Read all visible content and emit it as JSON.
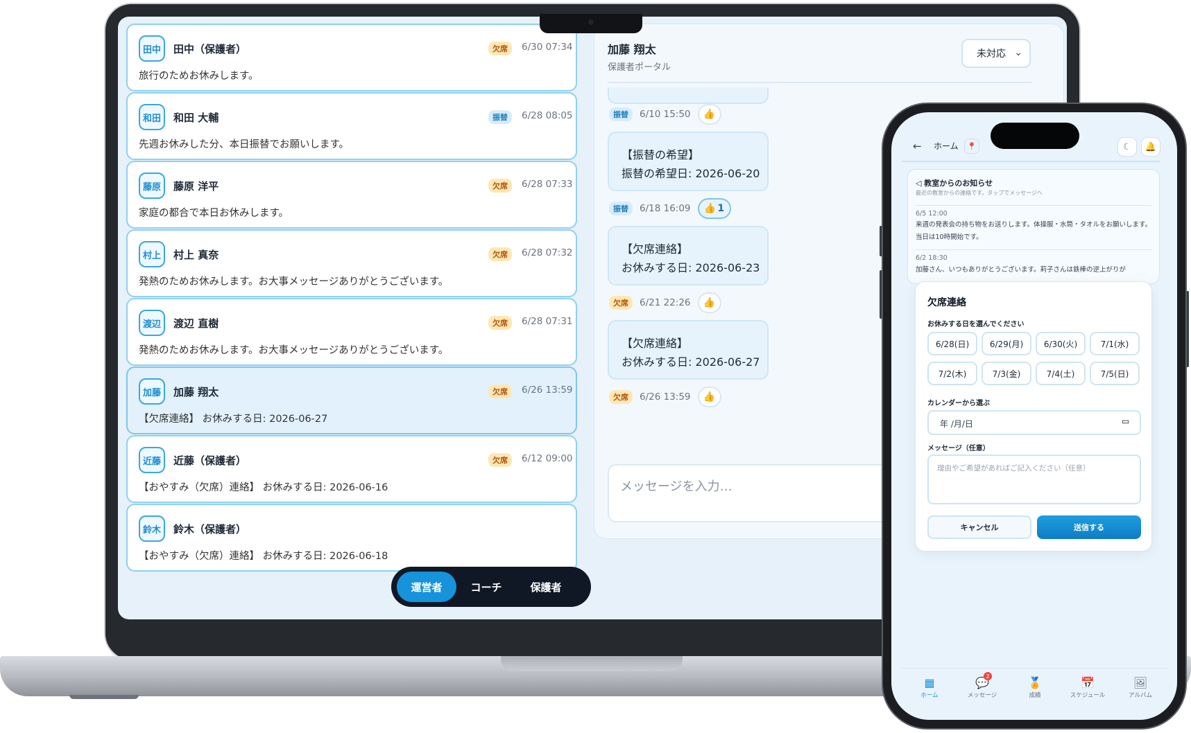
{
  "conversations": [
    {
      "badge": "田中",
      "name": "田中（保護者）",
      "tag": "欠席",
      "tag_type": "kesseki",
      "time": "6/30 07:34",
      "message": "旅行のためお休みします。"
    },
    {
      "badge": "和田",
      "name": "和田 大輔",
      "tag": "振替",
      "tag_type": "furikae",
      "time": "6/28 08:05",
      "message": "先週お休みした分、本日振替でお願いします。"
    },
    {
      "badge": "藤原",
      "name": "藤原 洋平",
      "tag": "欠席",
      "tag_type": "kesseki",
      "time": "6/28 07:33",
      "message": "家庭の都合で本日お休みします。"
    },
    {
      "badge": "村上",
      "name": "村上 真奈",
      "tag": "欠席",
      "tag_type": "kesseki",
      "time": "6/28 07:32",
      "message": "発熱のためお休みします。お大事メッセージありがとうございます。"
    },
    {
      "badge": "渡辺",
      "name": "渡辺 直樹",
      "tag": "欠席",
      "tag_type": "kesseki",
      "time": "6/28 07:31",
      "message": "発熱のためお休みします。お大事メッセージありがとうございます。"
    },
    {
      "badge": "加藤",
      "name": "加藤 翔太",
      "tag": "欠席",
      "tag_type": "kesseki",
      "time": "6/26 13:59",
      "message": "【欠席連絡】 お休みする日: 2026-06-27"
    },
    {
      "badge": "近藤",
      "name": "近藤（保護者）",
      "tag": "欠席",
      "tag_type": "kesseki",
      "time": "6/12 09:00",
      "message": "【おやすみ（欠席）連絡】 お休みする日: 2026-06-16"
    },
    {
      "badge": "鈴木",
      "name": "鈴木（保護者）",
      "tag": "",
      "tag_type": "",
      "time": "",
      "message": "【おやすみ（欠席）連絡】 お休みする日: 2026-06-18"
    }
  ],
  "chat": {
    "name": "加藤 翔太",
    "subtitle": "保護者ポータル",
    "status": "未対応",
    "messages": [
      {
        "tag": "振替",
        "tag_type": "furikae",
        "time": "6/10 15:50",
        "like": "👍",
        "like_count": ""
      },
      {
        "bubble_line1": "【振替の希望】",
        "bubble_line2": "振替の希望日: 2026-06-20"
      },
      {
        "tag": "振替",
        "tag_type": "furikae",
        "time": "6/18 16:09",
        "like": "👍",
        "like_count": "1"
      },
      {
        "bubble_line1": "【欠席連絡】",
        "bubble_line2": "お休みする日: 2026-06-23"
      },
      {
        "tag": "欠席",
        "tag_type": "kesseki",
        "time": "6/21 22:26",
        "like": "👍",
        "like_count": ""
      },
      {
        "bubble_line1": "【欠席連絡】",
        "bubble_line2": "お休みする日: 2026-06-27"
      },
      {
        "tag": "欠席",
        "tag_type": "kesseki",
        "time": "6/26 13:59",
        "like": "👍",
        "like_count": ""
      }
    ],
    "input_placeholder": "メッセージを入力…"
  },
  "role_switch": {
    "items": [
      "運営者",
      "コーチ",
      "保護者"
    ],
    "active": "運営者"
  },
  "phone": {
    "header": {
      "back": "←",
      "title": "ホーム",
      "pin": "📍",
      "theme": "☾",
      "bell": "🔔"
    },
    "notice": {
      "title": "◁ 教室からのお知らせ",
      "subtitle": "最近の教室からの連絡です。タップでメッセージへ",
      "items": [
        {
          "date": "6/5 12:00",
          "text": "来週の発表会の持ち物をお送りします。体操服・水筒・タオルをお願いします。当日は10時開始です。"
        },
        {
          "date": "6/2 18:30",
          "text": "加藤さん、いつもありがとうございます。莉子さんは鉄棒の逆上がりが"
        }
      ]
    },
    "modal": {
      "title": "欠席連絡",
      "choose_label": "お休みする日を選んでください",
      "dates": [
        "6/28(日)",
        "6/29(月)",
        "6/30(火)",
        "7/1(水)",
        "7/2(木)",
        "7/3(金)",
        "7/4(土)",
        "7/5(日)"
      ],
      "calendar_label": "カレンダーから選ぶ",
      "calendar_value": "年 /月/日",
      "message_label": "メッセージ（任意）",
      "message_placeholder": "理由やご希望があればご記入ください（任意）",
      "cancel": "キャンセル",
      "send": "送信する"
    },
    "tabs": [
      {
        "label": "ホーム",
        "icon": "▦",
        "active": true
      },
      {
        "label": "メッセージ",
        "icon": "💬",
        "badge": "2"
      },
      {
        "label": "成績",
        "icon": "🏅"
      },
      {
        "label": "スケジュール",
        "icon": "📅"
      },
      {
        "label": "アルバム",
        "icon": "🖼"
      }
    ]
  },
  "colors": {
    "accent": "#1793dc",
    "tag_absent_bg": "#fde8b5",
    "tag_transfer_bg": "#d7ecfb",
    "dark_pill": "#101826"
  }
}
